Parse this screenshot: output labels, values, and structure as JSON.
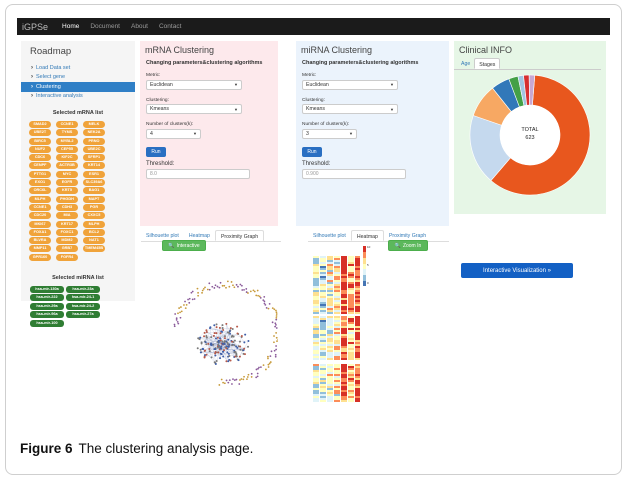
{
  "app": {
    "brand": "iGPSe",
    "nav": [
      "Home",
      "Document",
      "About",
      "Contact"
    ]
  },
  "sidebar": {
    "title": "Roadmap",
    "menu": [
      {
        "label": "Load Data set",
        "active": false
      },
      {
        "label": "Select gene",
        "active": false
      },
      {
        "label": "Clustering",
        "active": true
      },
      {
        "label": "Interactive analysis",
        "active": false
      }
    ],
    "mrna_title": "Selected mRNA list",
    "mrna_genes": [
      "SMAD2",
      "CCNE1",
      "MELK",
      "UBE2T",
      "TYMS",
      "NEK2A",
      "BIRC5",
      "MYBL2",
      "PRNO",
      "NUF2",
      "CEP55",
      "UBE2C",
      "CDC6",
      "KIF2C",
      "SFRP1",
      "CENPF",
      "ACTR3B",
      "KRT14",
      "PTTG1",
      "MYC",
      "ESR1",
      "EXO1",
      "EGFR",
      "SLC39A6",
      "ORC6L",
      "KRT5",
      "BAG1",
      "MLPH",
      "PHGDH",
      "MAPT",
      "CCNE1",
      "CDH3",
      "PGR",
      "CDC20",
      "MIA",
      "CXXC5",
      "MKI67",
      "KRT17",
      "MLPH",
      "FOXA1",
      "FOXC1",
      "BCL2",
      "BLVRA",
      "MDM2",
      "NAT1",
      "MMP11",
      "GRB7",
      "TMEM45B",
      "GPR160",
      "FGFR4"
    ],
    "mirna_title": "Selected miRNA list",
    "mirnas": [
      "hsa-mir-130a",
      "hsa-mir-23a",
      "hsa-mir-222",
      "hsa-mir-24-1",
      "hsa-mir-29a",
      "hsa-mir-24-2",
      "hsa-mir-96a",
      "hsa-mir-27a",
      "hsa-mir-100"
    ]
  },
  "mrna": {
    "title": "mRNA Clustering",
    "subtitle": "Changing parameters&clustering algorithms",
    "metric_label": "Metric:",
    "metric": "Euclidean",
    "clustering_label": "Clustering:",
    "clustering": "Kmeans",
    "clusters_label": "Number of clusters(k):",
    "clusters": "4",
    "run": "Run",
    "threshold_label": "Threshold:",
    "threshold_placeholder": "8.0",
    "tabs": [
      "Silhouette plot",
      "Heatmap",
      "Proximity Graph"
    ],
    "interactive_btn": "Interactive"
  },
  "mirna": {
    "title": "miRNA Clustering",
    "subtitle": "Changing parameters&clustering algorithms",
    "metric_label": "Metric:",
    "metric": "Euclidean",
    "clustering_label": "Clustering:",
    "clustering": "Kmeans",
    "clusters_label": "Number of clusters(k):",
    "clusters": "3",
    "run": "Run",
    "threshold_label": "Threshold:",
    "threshold_placeholder": "0.900",
    "tabs": [
      "Silhouette plot",
      "Heatmap",
      "Proximity Graph"
    ],
    "zoom_btn": "Zoom In"
  },
  "clinical": {
    "title": "Clinical INFO",
    "tabs": [
      "Age",
      "Stages"
    ],
    "donut_label": "TOTAL",
    "donut_total": "623",
    "slices": [
      {
        "value": 60,
        "color": "#e8571e"
      },
      {
        "value": 19,
        "color": "#c5d9ee"
      },
      {
        "value": 9,
        "color": "#f7a863"
      },
      {
        "value": 5,
        "color": "#3278b9"
      },
      {
        "value": 2.5,
        "color": "#44a047"
      },
      {
        "value": 1.5,
        "color": "#a2c6e2"
      },
      {
        "value": 1.5,
        "color": "#d62f2f"
      },
      {
        "value": 1.5,
        "color": "#c8a8d2"
      }
    ],
    "viz_btn": "Interactive Visualization »"
  },
  "heatmap_scale": {
    "top": "10",
    "mid": "5",
    "bottom": "0"
  },
  "caption": {
    "figure": "Figure 6",
    "text": "The clustering analysis page."
  }
}
